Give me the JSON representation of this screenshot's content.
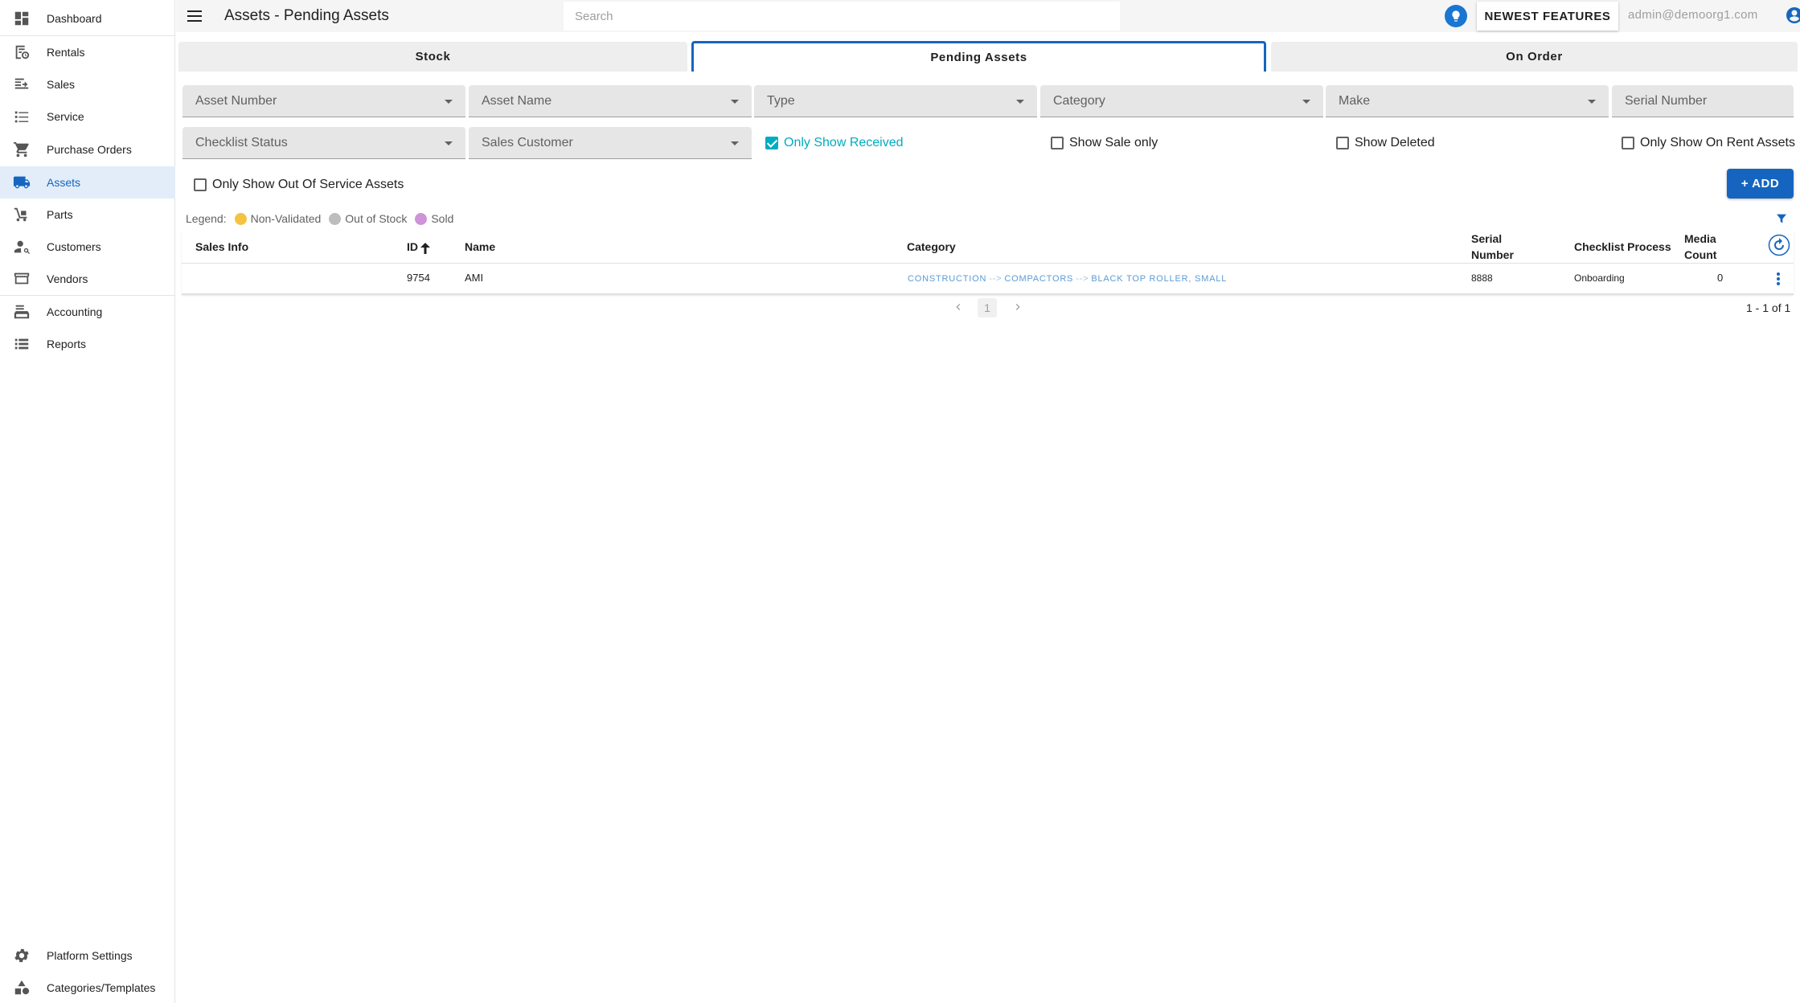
{
  "sidebar": {
    "items": [
      {
        "label": "Dashboard",
        "icon": "dashboard-icon"
      },
      {
        "label": "Rentals",
        "icon": "rentals-icon"
      },
      {
        "label": "Sales",
        "icon": "sales-icon"
      },
      {
        "label": "Service",
        "icon": "service-icon"
      },
      {
        "label": "Purchase Orders",
        "icon": "cart-icon"
      },
      {
        "label": "Assets",
        "icon": "truck-icon",
        "active": true
      },
      {
        "label": "Parts",
        "icon": "parts-icon"
      },
      {
        "label": "Customers",
        "icon": "customers-icon"
      },
      {
        "label": "Vendors",
        "icon": "vendors-icon"
      },
      {
        "label": "Accounting",
        "icon": "accounting-icon"
      },
      {
        "label": "Reports",
        "icon": "reports-icon"
      }
    ],
    "bottom_items": [
      {
        "label": "Platform Settings",
        "icon": "gear-icon"
      },
      {
        "label": "Categories/Templates",
        "icon": "shapes-icon"
      }
    ]
  },
  "header": {
    "title": "Assets - Pending Assets",
    "search_placeholder": "Search",
    "newest_features_label": "NEWEST FEATURES",
    "user_email": "admin@demoorg1.com"
  },
  "tabs": [
    {
      "label": "Stock",
      "active": false
    },
    {
      "label": "Pending Assets",
      "active": true
    },
    {
      "label": "On Order",
      "active": false
    }
  ],
  "filters": {
    "selects_row1": [
      "Asset Number",
      "Asset Name",
      "Type",
      "Category",
      "Make",
      "Serial Number"
    ],
    "selects_row2": [
      "Checklist Status",
      "Sales Customer"
    ],
    "checkboxes": [
      {
        "label": "Only Show Received",
        "checked": true
      },
      {
        "label": "Show Sale only",
        "checked": false
      },
      {
        "label": "Show Deleted",
        "checked": false
      },
      {
        "label": "Only Show On Rent Assets",
        "checked": false
      },
      {
        "label": "Only Show Out Of Service Assets",
        "checked": false
      }
    ],
    "add_label": "+ ADD"
  },
  "legend": {
    "label": "Legend:",
    "items": [
      {
        "label": "Non-Validated",
        "color": "#f5c242"
      },
      {
        "label": "Out of Stock",
        "color": "#bdbdbd"
      },
      {
        "label": "Sold",
        "color": "#ce93d8"
      }
    ]
  },
  "table": {
    "columns": {
      "sales_info": "Sales Info",
      "id": "ID",
      "name": "Name",
      "category": "Category",
      "serial_line1": "Serial",
      "serial_line2": "Number",
      "checklist": "Checklist Process",
      "media_line1": "Media",
      "media_line2": "Count"
    },
    "rows": [
      {
        "sales_info": "",
        "id": "9754",
        "name": "AMI",
        "category_path": [
          "CONSTRUCTION",
          "COMPACTORS",
          "BLACK TOP ROLLER, SMALL"
        ],
        "category_sep": "-->",
        "serial": "8888",
        "checklist": "Onboarding",
        "media_count": "0"
      }
    ]
  },
  "pagination": {
    "current_page": "1",
    "range": "1 - 1 of 1"
  },
  "colors": {
    "accent": "#1565c0",
    "checked": "#00acc1",
    "active_nav_bg": "#e3edf9"
  }
}
